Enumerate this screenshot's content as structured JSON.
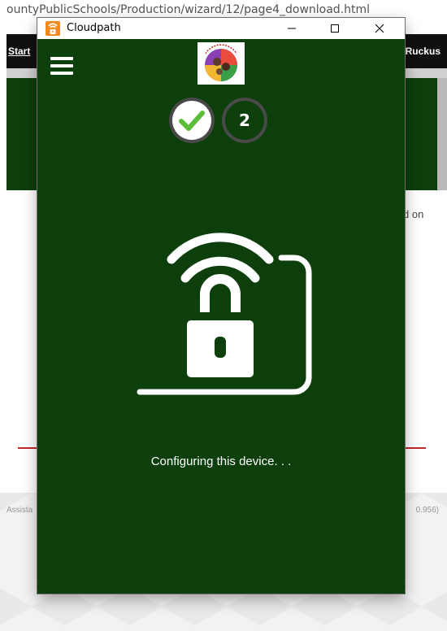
{
  "background_page": {
    "url_text": "ountyPublicSchools/Production/wizard/12/page4_download.html",
    "nav_left": "Start",
    "nav_right": "Ruckus",
    "side_text": "d on",
    "footer_left": "Assista",
    "footer_right": "0.956)"
  },
  "window": {
    "title": "Cloudpath",
    "icon": "cloudpath-lock-wifi-icon",
    "controls": [
      "minimize-icon",
      "maximize-icon",
      "close-icon"
    ]
  },
  "app": {
    "menu_icon": "hamburger-menu-icon",
    "steps": [
      {
        "state": "completed",
        "icon": "checkmark-icon"
      },
      {
        "state": "current",
        "label": "2"
      }
    ],
    "illustration": "wifi-lock-icon",
    "status": "Configuring this device. . ."
  },
  "colors": {
    "app_background": "#0d3f0c",
    "step_ring": "#4a4a4a",
    "check_green": "#5cbd3a",
    "app_icon_orange": "#f08a1e",
    "accent_red": "#c0262c"
  }
}
